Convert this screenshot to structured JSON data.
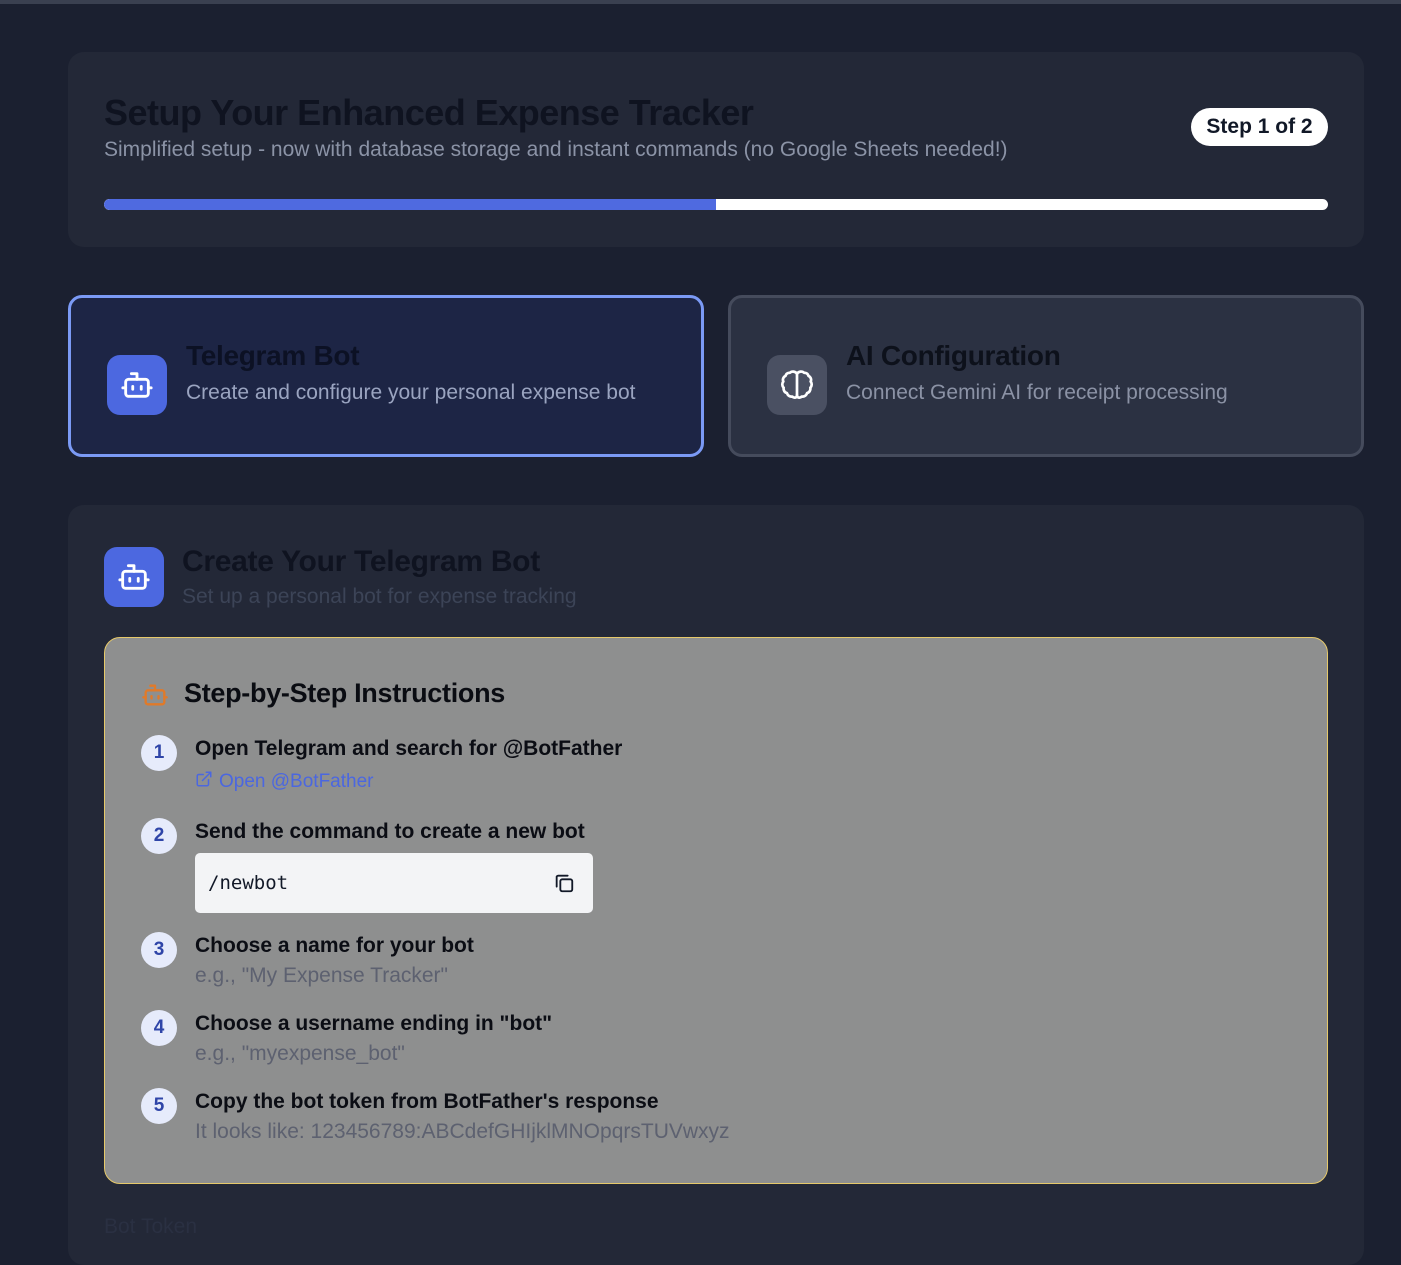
{
  "header": {
    "title": "Setup Your Enhanced Expense Tracker",
    "subtitle": "Simplified setup - now with database storage and instant commands (no Google Sheets needed!)",
    "step_badge": "Step 1 of 2",
    "progress_percent": 50
  },
  "steps": [
    {
      "title": "Telegram Bot",
      "description": "Create and configure your personal expense bot",
      "icon": "bot-icon",
      "active": true
    },
    {
      "title": "AI Configuration",
      "description": "Connect Gemini AI for receipt processing",
      "icon": "brain-icon",
      "active": false
    }
  ],
  "main": {
    "title": "Create Your Telegram Bot",
    "subtitle": "Set up a personal bot for expense tracking",
    "instructions": {
      "title": "Step-by-Step Instructions",
      "items": [
        {
          "number": "1",
          "title": "Open Telegram and search for @BotFather",
          "link_label": "Open @BotFather"
        },
        {
          "number": "2",
          "title": "Send the command to create a new bot",
          "code": "/newbot"
        },
        {
          "number": "3",
          "title": "Choose a name for your bot",
          "hint": "e.g., \"My Expense Tracker\""
        },
        {
          "number": "4",
          "title": "Choose a username ending in \"bot\"",
          "hint": "e.g., \"myexpense_bot\""
        },
        {
          "number": "5",
          "title": "Copy the bot token from BotFather's response",
          "hint": "It looks like: 123456789:ABCdefGHIjklMNOpqrsTUVwxyz"
        }
      ]
    },
    "token_label": "Bot Token"
  },
  "colors": {
    "background": "#1b2030",
    "card": "#232837",
    "accent": "#4c68e0",
    "active_border": "#7b9af5",
    "instructions_bg": "#8e8f8f",
    "instructions_border": "#e6c96a",
    "orange_icon": "#e07a2a"
  }
}
